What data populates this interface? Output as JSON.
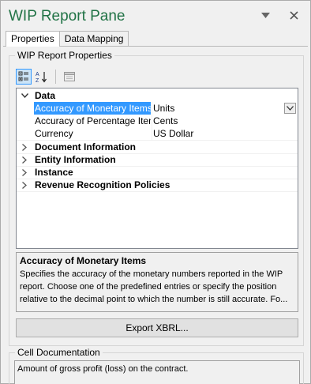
{
  "pane": {
    "title": "WIP Report Pane"
  },
  "title_buttons": [
    {
      "icon": "chevron-down-icon",
      "glyph": "▼"
    },
    {
      "icon": "close-icon",
      "glyph": "✕"
    }
  ],
  "tabs": [
    {
      "label": "Properties",
      "active": true
    },
    {
      "label": "Data Mapping",
      "active": false
    }
  ],
  "properties_group": {
    "legend": "WIP Report Properties"
  },
  "toolbar": {
    "items": [
      {
        "icon": "categorized-icon",
        "pressed": true
      },
      {
        "icon": "sort-alphabetical-icon",
        "pressed": false
      },
      {
        "icon": "property-pages-icon",
        "pressed": false
      }
    ]
  },
  "grid": {
    "categories": [
      {
        "label": "Data",
        "expanded": true
      },
      {
        "label": "Document Information",
        "expanded": false
      },
      {
        "label": "Entity Information",
        "expanded": false
      },
      {
        "label": "Instance",
        "expanded": false
      },
      {
        "label": "Revenue Recognition Policies",
        "expanded": false
      }
    ],
    "data_properties": [
      {
        "name": "Accuracy of Monetary Items",
        "value": "Units",
        "selected": true
      },
      {
        "name": "Accuracy of Percentage Items",
        "value": "Cents",
        "selected": false
      },
      {
        "name": "Currency",
        "value": "US Dollar",
        "selected": false
      }
    ]
  },
  "description": {
    "title": "Accuracy of Monetary Items",
    "text": "Specifies the accuracy of the monetary numbers reported in the WIP report. Choose one of the predefined entries or specify the position relative to the decimal point to which the number is still accurate. Fo..."
  },
  "export_button": {
    "label": "Export XBRL..."
  },
  "cell_documentation": {
    "legend": "Cell Documentation",
    "text": "Amount of gross profit (loss) on the contract."
  },
  "colors": {
    "title": "#217346",
    "selection": "#3399ff"
  }
}
